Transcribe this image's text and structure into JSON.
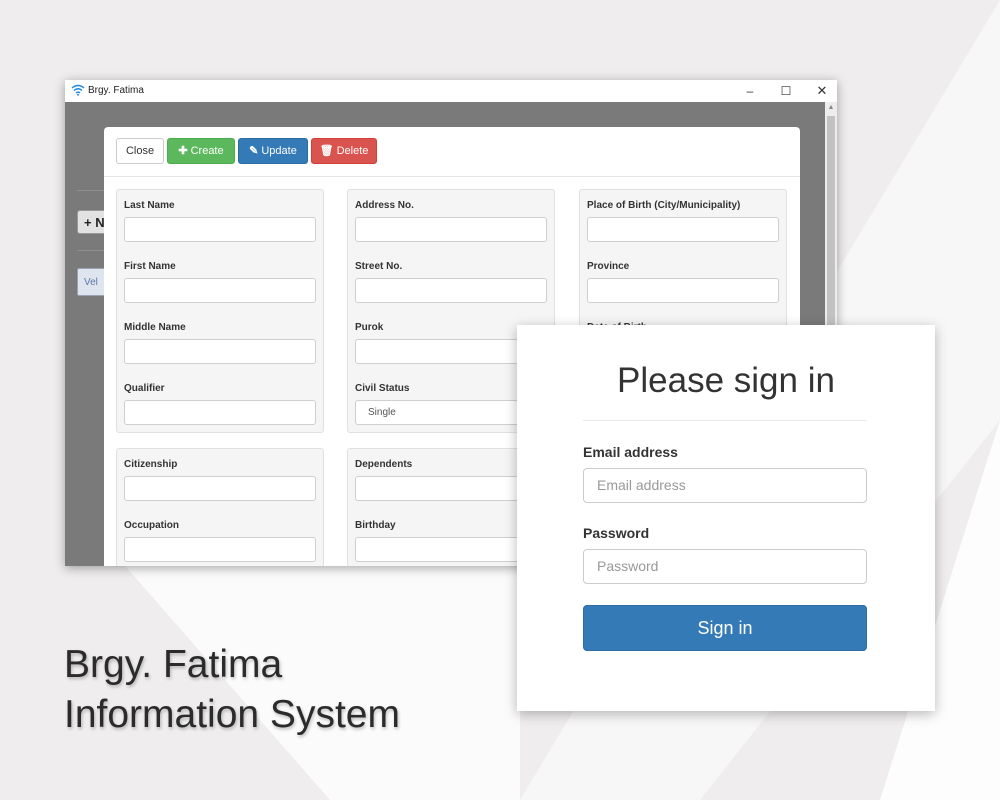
{
  "window": {
    "title": "Brgy. Fatima",
    "controls": {
      "minimize": "–",
      "maximize": "☐",
      "close": "✕"
    }
  },
  "background_app": {
    "button_text": "+ N",
    "tab_text": "Vel"
  },
  "toolbar": {
    "close_label": "Close",
    "create_label": "Create",
    "update_label": "Update",
    "delete_label": "Delete"
  },
  "form": {
    "column1": {
      "group1": {
        "last_name": {
          "label": "Last Name",
          "value": ""
        },
        "first_name": {
          "label": "First Name",
          "value": ""
        },
        "middle_name": {
          "label": "Middle Name",
          "value": ""
        },
        "qualifier": {
          "label": "Qualifier",
          "value": ""
        }
      },
      "group2": {
        "citizenship": {
          "label": "Citizenship",
          "value": ""
        },
        "occupation": {
          "label": "Occupation",
          "value": ""
        }
      }
    },
    "column2": {
      "group1": {
        "address_no": {
          "label": "Address No.",
          "value": ""
        },
        "street_no": {
          "label": "Street No.",
          "value": ""
        },
        "purok": {
          "label": "Purok",
          "value": ""
        },
        "civil_status": {
          "label": "Civil Status",
          "value": "Single"
        }
      },
      "group2": {
        "dependents": {
          "label": "Dependents",
          "value": ""
        },
        "birthday": {
          "label": "Birthday",
          "value": ""
        }
      }
    },
    "column3": {
      "place_of_birth": {
        "label": "Place of Birth (City/Municipality)",
        "value": ""
      },
      "province": {
        "label": "Province",
        "value": ""
      },
      "date_of_birth": {
        "label": "Date of Birth"
      }
    }
  },
  "signin": {
    "heading": "Please sign in",
    "email_label": "Email address",
    "email_placeholder": "Email address",
    "password_label": "Password",
    "password_placeholder": "Password",
    "button_label": "Sign in"
  },
  "caption": {
    "line1": "Brgy. Fatima",
    "line2": "Information System"
  },
  "colors": {
    "primary": "#337ab7",
    "success": "#5cb85c",
    "danger": "#d9534f",
    "backdrop": "#7a7a7a"
  }
}
